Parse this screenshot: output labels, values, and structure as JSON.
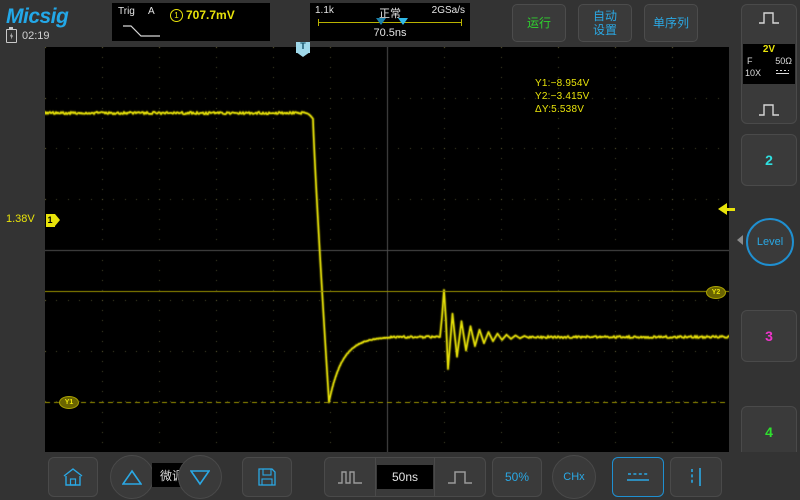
{
  "brand": {
    "name": "Micsig",
    "clock": "02:19",
    "battery_icon": "battery-charging-icon"
  },
  "trigger_panel": {
    "label": "Trig",
    "source": "A",
    "channel_badge": "1",
    "level": "707.7mV",
    "slope_icon": "falling-edge-icon"
  },
  "timebase_panel": {
    "memory_depth": "1.1k",
    "acq_mode": "正常",
    "sample_rate": "2GSa/s",
    "delay": "70.5ns",
    "marker_icon": "trigger-position-marker"
  },
  "top_buttons": [
    {
      "name": "run-button",
      "label": "运行",
      "color": "#2fd02f"
    },
    {
      "name": "autoset-button",
      "label": "自动\n设置",
      "line1": "自动",
      "line2": "设置",
      "color": "#2aa8e4"
    },
    {
      "name": "single-sequence-button",
      "label": "单序列",
      "color": "#2aa8e4"
    }
  ],
  "scope": {
    "cursor_measurements": {
      "y1": "Y1:−8.954V",
      "y2": "Y2:−3.415V",
      "dy": "ΔY:5.538V"
    },
    "channel_offset_label": "1.38V",
    "channel_marker": "1",
    "cursor_labels": {
      "y1": "Y1",
      "y2": "Y2"
    },
    "trigger_level_marker": "trigger-level-arrow-icon",
    "waveform_color": "#e8e30a",
    "grid_color": "#4a4a2a",
    "cursor_color": "#9a9200"
  },
  "sidebar": {
    "channel1": {
      "top_icon": "pulse-up-icon",
      "bottom_icon": "pulse-up-icon",
      "volts_div": "2V",
      "filter": "F",
      "impedance": "50Ω",
      "probe": "10X",
      "coupling_icon": "dc-coupling-icon"
    },
    "channel2": {
      "label": "2",
      "color": "#2ee0e0"
    },
    "channel3": {
      "label": "3",
      "color": "#ec34c9"
    },
    "channel4": {
      "label": "4",
      "color": "#2ee02e"
    },
    "level_knob": {
      "label": "Level",
      "color": "#2aa8e4"
    }
  },
  "bottom_bar": {
    "home_icon": "home-icon",
    "increase_icon": "triangle-up-icon",
    "decrease_icon": "triangle-down-icon",
    "fine_label": "微调",
    "save_icon": "floppy-save-icon",
    "timebase_zoom_out_icon": "narrow-pulse-icon",
    "timebase_value": "50ns",
    "timebase_zoom_in_icon": "wide-pulse-icon",
    "fifty_percent_label": "50%",
    "chx_label": "CHx",
    "horizontal_cursor_icon": "horizontal-cursor-icon",
    "vertical_cursor_icon": "vertical-cursor-icon"
  }
}
